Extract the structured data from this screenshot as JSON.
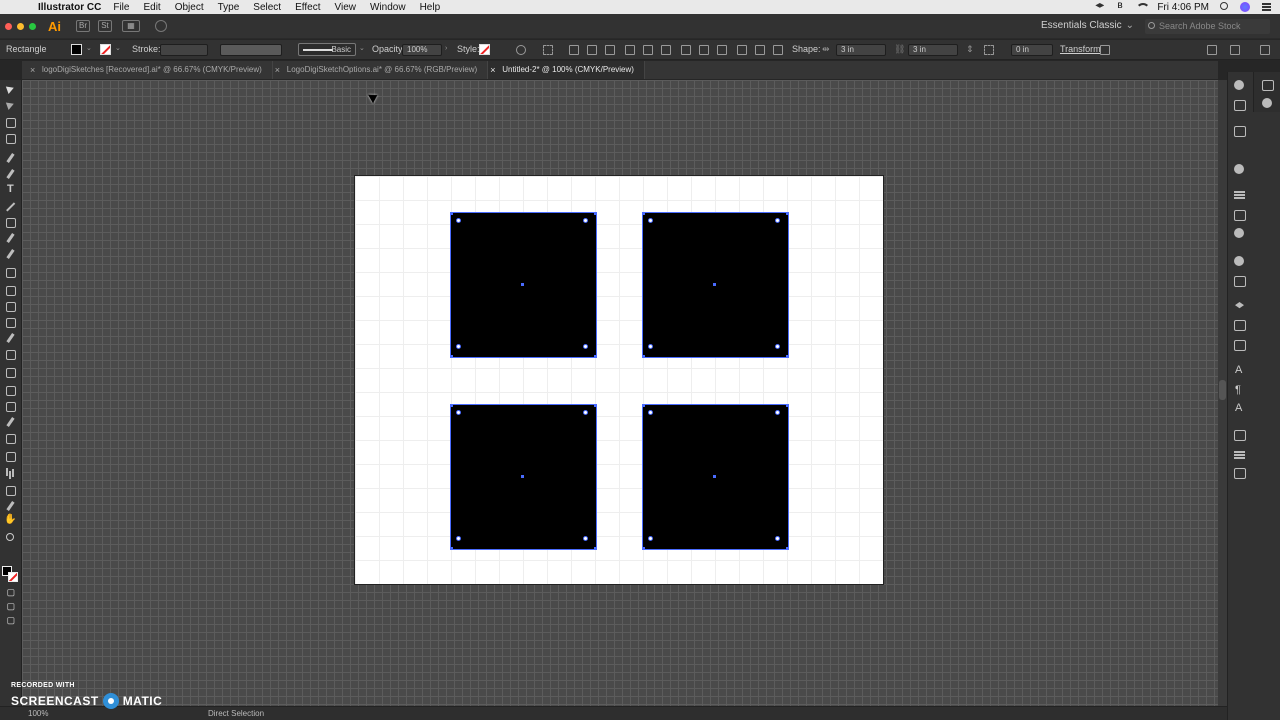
{
  "menubar": {
    "app_name": "Illustrator CC",
    "items": [
      "File",
      "Edit",
      "Object",
      "Type",
      "Select",
      "Effect",
      "View",
      "Window",
      "Help"
    ],
    "clock": "Fri 4:06 PM"
  },
  "appbar": {
    "logo": "Ai",
    "workspace": "Essentials Classic",
    "stock_placeholder": "Search Adobe Stock"
  },
  "control": {
    "selection_label": "Rectangle",
    "stroke_label": "Stroke:",
    "brush_label": "Basic",
    "opacity_label": "Opacity:",
    "opacity_value": "100%",
    "style_label": "Style:",
    "shape_label": "Shape:",
    "width_value": "3 in",
    "height_value": "3 in",
    "corner_value": "0 in",
    "transform_label": "Transform"
  },
  "tabs": [
    {
      "label": "logoDigiSketches [Recovered].ai* @ 66.67% (CMYK/Preview)",
      "active": false
    },
    {
      "label": "LogoDigiSketchOptions.ai* @ 66.67% (RGB/Preview)",
      "active": false
    },
    {
      "label": "Untitled-2* @ 100% (CMYK/Preview)",
      "active": true
    }
  ],
  "status": {
    "zoom": "100%",
    "tool_name": "Direct Selection"
  },
  "watermark": {
    "recorded": "RECORDED WITH",
    "brand_left": "SCREENCAST",
    "brand_right": "MATIC"
  },
  "colors": {
    "accent_selection": "#4a6cff",
    "shape_fill": "#000000",
    "artboard": "#ffffff"
  }
}
